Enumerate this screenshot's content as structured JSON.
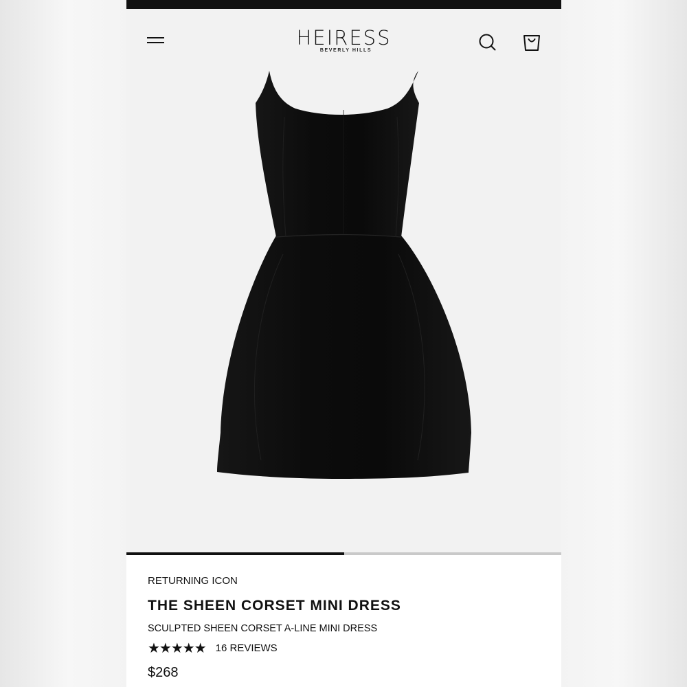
{
  "brand": {
    "name": "HEIRESS",
    "location": "BEVERLY HILLS"
  },
  "header": {
    "menu_icon": "hamburger-menu-icon",
    "search_icon": "search-icon",
    "cart_icon": "shopping-bag-icon"
  },
  "gallery": {
    "progress": 0.5
  },
  "product": {
    "collection": "RETURNING ICON",
    "title": "THE SHEEN CORSET MINI DRESS",
    "subtitle": "SCULPTED SHEEN CORSET A-LINE MINI DRESS",
    "rating": 5,
    "stars": "★★★★★",
    "reviews": "16 REVIEWS",
    "price": "$268"
  },
  "colors": {
    "accent": "#111111",
    "background": "#f2f2f2"
  }
}
